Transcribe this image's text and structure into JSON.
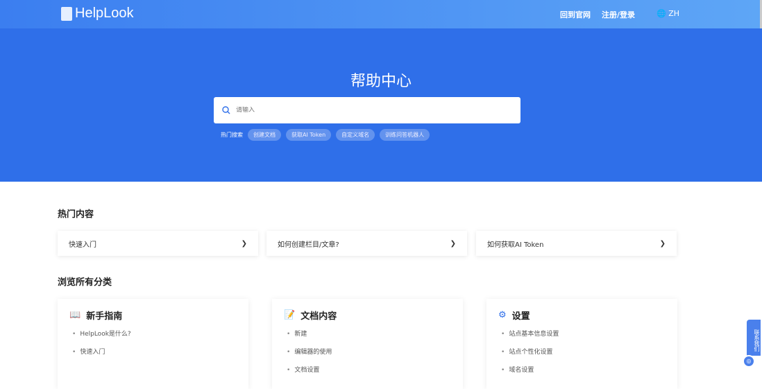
{
  "header": {
    "logo": "HelpLook",
    "nav": [
      "回到官网",
      "注册/登录"
    ],
    "lang": "ZH"
  },
  "hero": {
    "title": "帮助中心",
    "search_placeholder": "请输入",
    "hot_label": "热门搜索",
    "hot_tags": [
      "创建文档",
      "获取AI Token",
      "自定义域名",
      "训练问答机器人"
    ]
  },
  "popular": {
    "title": "热门内容",
    "items": [
      "快速入门",
      "如何创建栏目/文章?",
      "如何获取AI Token"
    ]
  },
  "categories": {
    "title": "浏览所有分类",
    "items": [
      {
        "title": "新手指南",
        "links": [
          "HelpLook是什么?",
          "快速入门"
        ]
      },
      {
        "title": "文档内容",
        "links": [
          "新建",
          "编辑器的使用",
          "文档设置"
        ]
      },
      {
        "title": "设置",
        "links": [
          "站点基本信息设置",
          "站点个性化设置",
          "域名设置"
        ]
      }
    ]
  },
  "contact": "联系我们"
}
